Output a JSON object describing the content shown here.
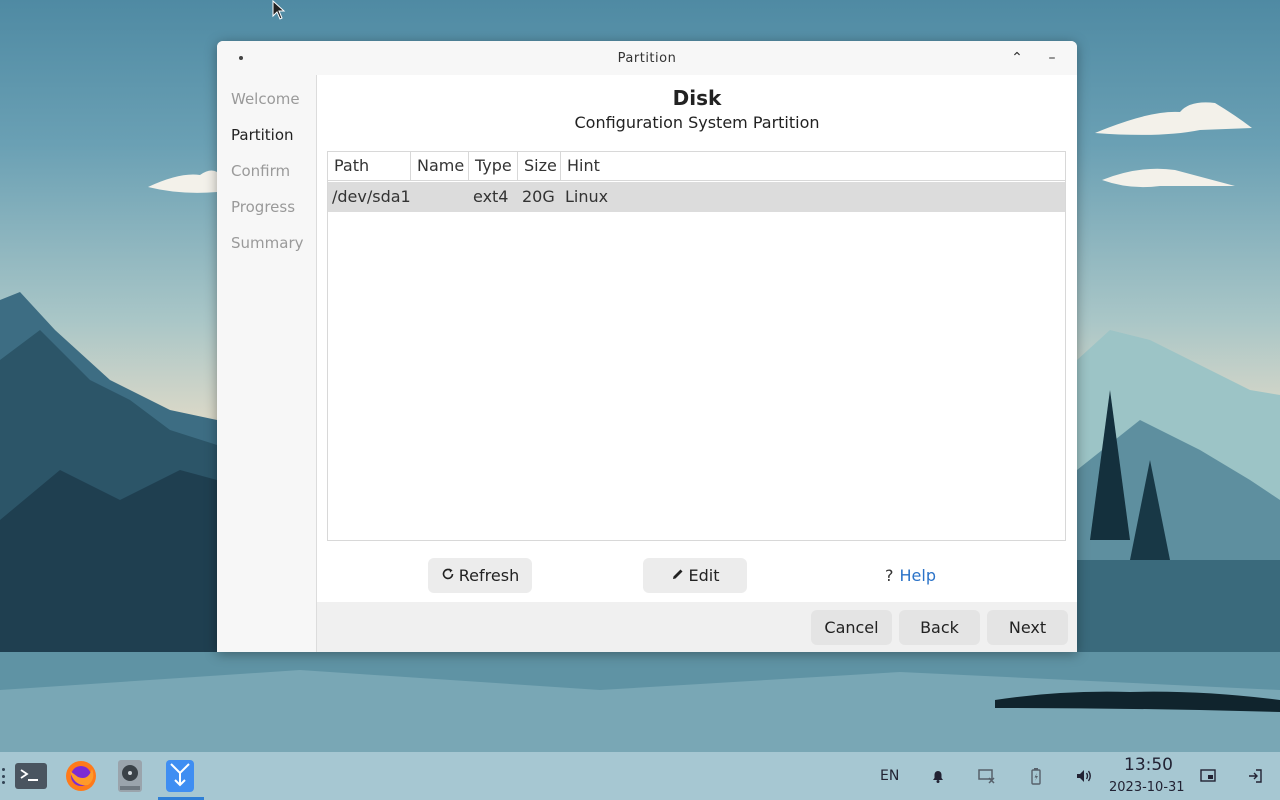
{
  "window": {
    "title": "Partition",
    "maximize_glyph": "⌃",
    "minimize_glyph": "–"
  },
  "sidebar": {
    "items": [
      {
        "label": "Welcome"
      },
      {
        "label": "Partition"
      },
      {
        "label": "Confirm"
      },
      {
        "label": "Progress"
      },
      {
        "label": "Summary"
      }
    ],
    "active": "Partition"
  },
  "main": {
    "heading": "Disk",
    "subheading": "Configuration System Partition",
    "table": {
      "columns": [
        "Path",
        "Name",
        "Type",
        "Size",
        "Hint"
      ],
      "rows": [
        {
          "path": "/dev/sda1",
          "name": "",
          "type": "ext4",
          "size": "20G",
          "hint": "Linux"
        }
      ]
    },
    "actions": {
      "refresh_label": "Refresh",
      "edit_label": "Edit",
      "help_glyph": "?",
      "help_label": "Help"
    }
  },
  "footer": {
    "cancel_label": "Cancel",
    "back_label": "Back",
    "next_label": "Next"
  },
  "taskbar": {
    "apps": [
      "terminal-icon",
      "firefox-icon",
      "disk-utility-icon",
      "installer-icon"
    ],
    "active_app": "installer",
    "language": "EN",
    "time": "13:50",
    "date": "2023-10-31"
  },
  "colors": {
    "accent": "#2f7fd6",
    "link": "#2b73c8",
    "taskbar": "#a6c7d2"
  }
}
